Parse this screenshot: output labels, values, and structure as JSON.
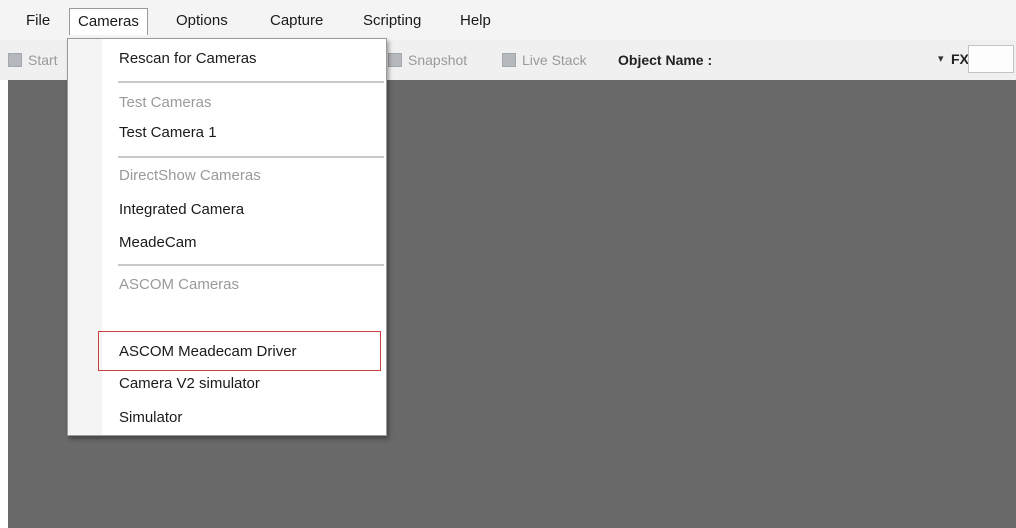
{
  "menubar": {
    "items": [
      "File",
      "Cameras",
      "Options",
      "Capture",
      "Scripting",
      "Help"
    ]
  },
  "toolbar": {
    "start_label": "Start",
    "snapshot_label": "Snapshot",
    "live_stack_label": "Live Stack",
    "object_name_label": "Object Name :",
    "dropdown_arrow": "▾",
    "fx_label": "FX :",
    "fx_value": ""
  },
  "cameras_menu": {
    "rescan": "Rescan for Cameras",
    "test_header": "Test Cameras",
    "test_camera_1": "Test Camera 1",
    "directshow_header": "DirectShow Cameras",
    "integrated_camera": "Integrated Camera",
    "meadecam": "MeadeCam",
    "ascom_header": "ASCOM Cameras",
    "ascom_meadecam_driver": "ASCOM Meadecam Driver",
    "camera_v2_simulator": "Camera V2 simulator",
    "simulator": "Simulator"
  },
  "colors": {
    "workspace": "#696969",
    "highlight_border": "#c84040",
    "disabled_text": "#9a9a9a"
  }
}
